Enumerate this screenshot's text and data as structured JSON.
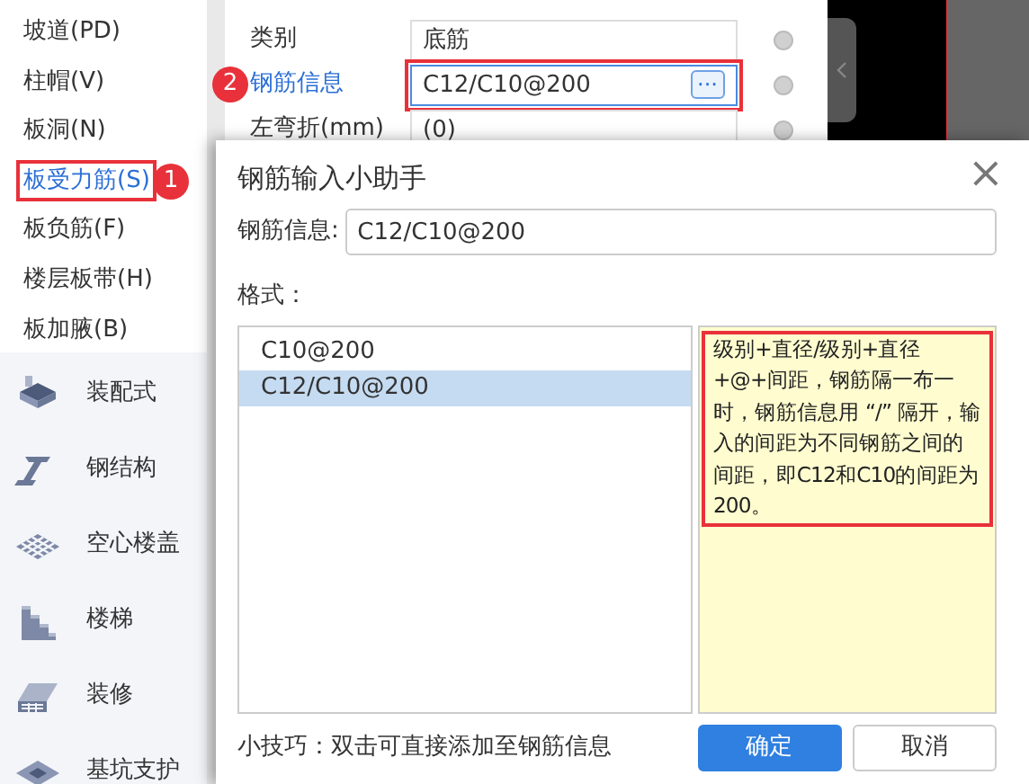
{
  "sidebar": {
    "items": [
      {
        "label": "坡道(PD)",
        "selected": false
      },
      {
        "label": "柱帽(V)",
        "selected": false
      },
      {
        "label": "板洞(N)",
        "selected": false
      },
      {
        "label": "板受力筋(S)",
        "selected": true,
        "callout": "1"
      },
      {
        "label": "板负筋(F)",
        "selected": false
      },
      {
        "label": "楼层板带(H)",
        "selected": false
      },
      {
        "label": "板加腋(B)",
        "selected": false
      }
    ],
    "categories": [
      {
        "label": "装配式",
        "kind": "prefab"
      },
      {
        "label": "钢结构",
        "kind": "beam"
      },
      {
        "label": "空心楼盖",
        "kind": "grid"
      },
      {
        "label": "楼梯",
        "kind": "stairs"
      },
      {
        "label": "装修",
        "kind": "finish"
      },
      {
        "label": "基坑支护",
        "kind": "pit"
      }
    ]
  },
  "properties": {
    "rows": [
      {
        "label": "类别",
        "value": "底筋",
        "selected": false
      },
      {
        "label": "钢筋信息",
        "value": "C12/C10@200",
        "selected": true,
        "callout": "2",
        "button": "···"
      },
      {
        "label": "左弯折(mm)",
        "value": "(0)",
        "selected": false
      }
    ]
  },
  "dialog": {
    "title": "钢筋输入小助手",
    "close": "×",
    "info_label": "钢筋信息:",
    "info_value": "C12/C10@200",
    "format_label": "格式：",
    "formats": [
      {
        "label": "C10@200",
        "selected": false
      },
      {
        "label": "C12/C10@200",
        "selected": true
      }
    ],
    "help": "级别+直径/级别+直径+@+间距，钢筋隔一布一时，钢筋信息用 “/” 隔开，输入的间距为不同钢筋之间的间距，即C12和C10的间距为200。",
    "tip": "小技巧：双击可直接添加至钢筋信息",
    "buttons": [
      {
        "label": "确定",
        "kind": "primary"
      },
      {
        "label": "取消",
        "kind": "secondary"
      }
    ]
  }
}
